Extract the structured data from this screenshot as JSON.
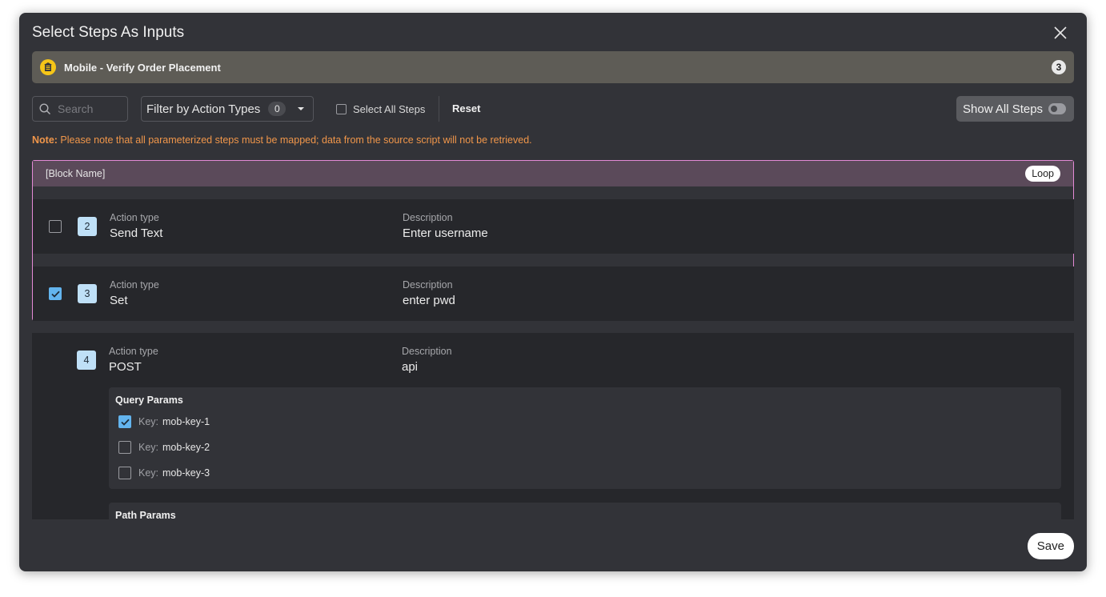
{
  "modal": {
    "title": "Select Steps As Inputs",
    "close_icon": "close-icon"
  },
  "script": {
    "icon": "script-icon",
    "name": "Mobile - Verify Order Placement",
    "count": "3"
  },
  "toolbar": {
    "search_placeholder": "Search",
    "filter_label": "Filter by Action Types",
    "filter_count": "0",
    "select_all_label": "Select All Steps",
    "select_all_checked": false,
    "reset_label": "Reset",
    "show_all_label": "Show All Steps",
    "show_all_on": false
  },
  "note": {
    "prefix": "Note:",
    "text": " Please note that all parameterized steps must be mapped; data from the source script will not be retrieved."
  },
  "block": {
    "name": "[Block Name]",
    "badge": "Loop",
    "steps": [
      {
        "number": "2",
        "action_label": "Action type",
        "action": "Send Text",
        "desc_label": "Description",
        "description": "Enter username",
        "checked": false
      },
      {
        "number": "3",
        "action_label": "Action type",
        "action": "Set",
        "desc_label": "Description",
        "description": "enter pwd",
        "checked": true
      }
    ]
  },
  "step4": {
    "number": "4",
    "action_label": "Action type",
    "action": "POST",
    "desc_label": "Description",
    "description": "api",
    "query_params": {
      "title": "Query Params",
      "items": [
        {
          "key_label": "Key:",
          "key": "mob-key-1",
          "checked": true
        },
        {
          "key_label": "Key:",
          "key": "mob-key-2",
          "checked": false
        },
        {
          "key_label": "Key:",
          "key": "mob-key-3",
          "checked": false
        }
      ]
    },
    "path_params": {
      "title": "Path Params"
    }
  },
  "footer": {
    "save_label": "Save"
  },
  "colors": {
    "modal_bg": "#323338",
    "row_bg": "#26272b",
    "accent_blue": "#63b4ee",
    "loop_border": "#e48ad6",
    "note": "#f0964a"
  }
}
